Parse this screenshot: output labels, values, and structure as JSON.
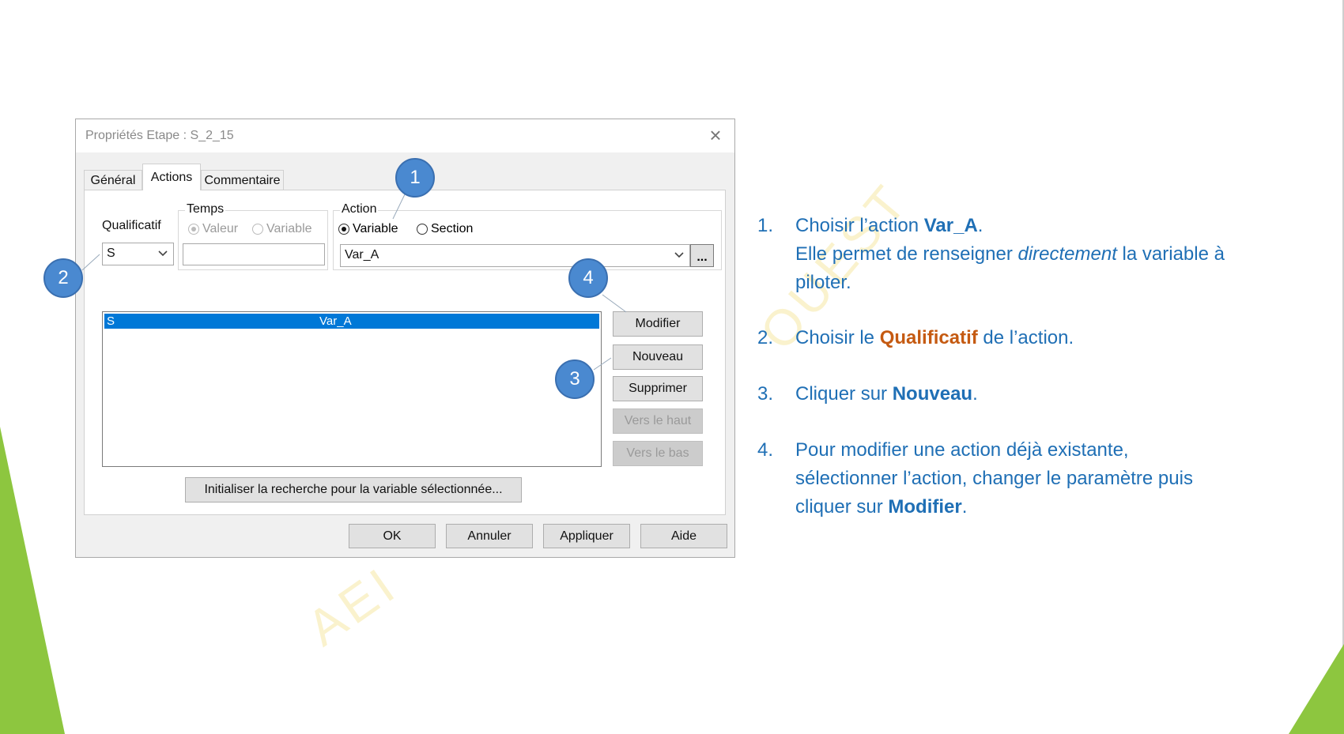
{
  "dialog": {
    "title": "Propriétés Etape : S_2_15",
    "tabs": [
      {
        "label": "Général"
      },
      {
        "label": "Actions"
      },
      {
        "label": "Commentaire"
      }
    ],
    "qualificatif": {
      "label": "Qualificatif",
      "value": "S"
    },
    "temps": {
      "label": "Temps",
      "options": [
        "Valeur",
        "Variable"
      ],
      "value_text": ""
    },
    "action": {
      "label": "Action",
      "options": [
        "Variable",
        "Section"
      ],
      "selected": "Variable",
      "value": "Var_A",
      "browse_label": "..."
    },
    "list": {
      "rows": [
        {
          "qualificatif": "S",
          "action": "Var_A"
        }
      ]
    },
    "side_buttons": {
      "modifier": "Modifier",
      "nouveau": "Nouveau",
      "supprimer": "Supprimer",
      "vers_le_haut": "Vers le haut",
      "vers_le_bas": "Vers le bas"
    },
    "init_button": "Initialiser la recherche pour la variable sélectionnée...",
    "footer_buttons": {
      "ok": "OK",
      "annuler": "Annuler",
      "appliquer": "Appliquer",
      "aide": "Aide"
    }
  },
  "callouts": [
    "1",
    "2",
    "3",
    "4"
  ],
  "instructions": {
    "step1": {
      "num": "1.",
      "a": "Choisir l’action ",
      "b": "Var_A",
      "c": ".",
      "line2a": "Elle permet de renseigner ",
      "line2i": "directement",
      "line2b": " la variable à",
      "line3": "piloter."
    },
    "step2": {
      "num": "2.",
      "a": "Choisir le ",
      "b": "Qualificatif",
      "c": " de l’action."
    },
    "step3": {
      "num": "3.",
      "a": "Cliquer sur ",
      "b": "Nouveau",
      "c": "."
    },
    "step4": {
      "num": "4.",
      "line1": "Pour modifier une action déjà existante,",
      "line2": "sélectionner l’action, changer le paramètre puis",
      "line3a": "cliquer sur ",
      "line3b": "Modifier",
      "line3c": "."
    }
  },
  "watermark": {
    "a": "AEI",
    "b": "OUEST"
  },
  "colors": {
    "accent_blue": "#1f6fb5",
    "accent_orange": "#c55a11",
    "callout_fill": "#4a89d0",
    "selection": "#0078d7",
    "deco_green": "#8dc63f"
  }
}
